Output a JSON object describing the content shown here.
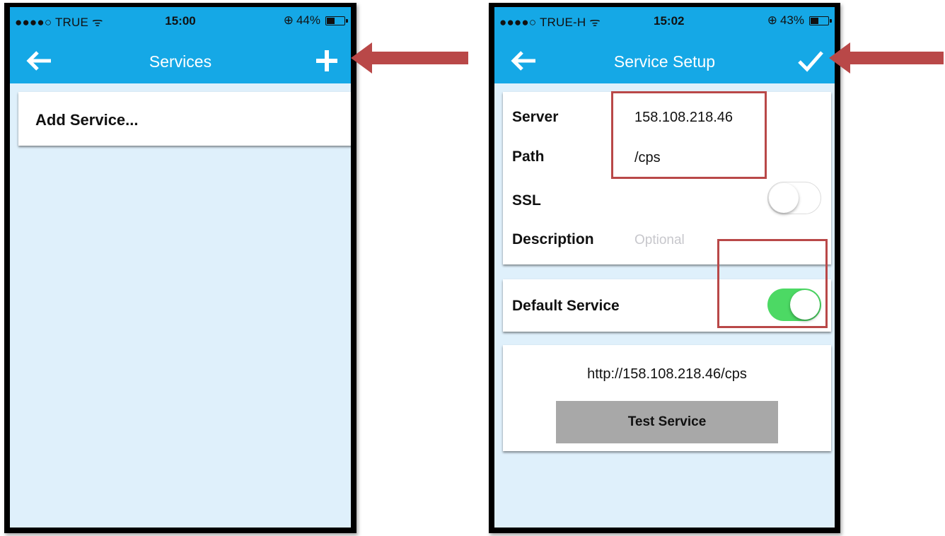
{
  "left": {
    "status": {
      "carrier": "●●●●○ TRUE ᯤ",
      "time": "15:00",
      "battery": "44%",
      "battery_level": 0.44
    },
    "nav": {
      "title": "Services",
      "action_icon": "plus-icon"
    },
    "list": {
      "add_service_label": "Add Service..."
    }
  },
  "right": {
    "status": {
      "carrier": "●●●●○ TRUE-H ᯤ",
      "time": "15:02",
      "battery": "43%",
      "battery_level": 0.43
    },
    "nav": {
      "title": "Service Setup",
      "action_icon": "checkmark-icon"
    },
    "form": {
      "server_label": "Server",
      "server_value": "158.108.218.46",
      "path_label": "Path",
      "path_value": "/cps",
      "ssl_label": "SSL",
      "ssl_on": false,
      "description_label": "Description",
      "description_placeholder": "Optional",
      "default_label": "Default Service",
      "default_on": true
    },
    "preview": {
      "url": "http://158.108.218.46/cps",
      "test_button": "Test Service"
    }
  },
  "colors": {
    "nav": "#15a8e6",
    "background": "#dff0fb",
    "annotation": "#b94848",
    "toggle_on": "#4cd964"
  }
}
